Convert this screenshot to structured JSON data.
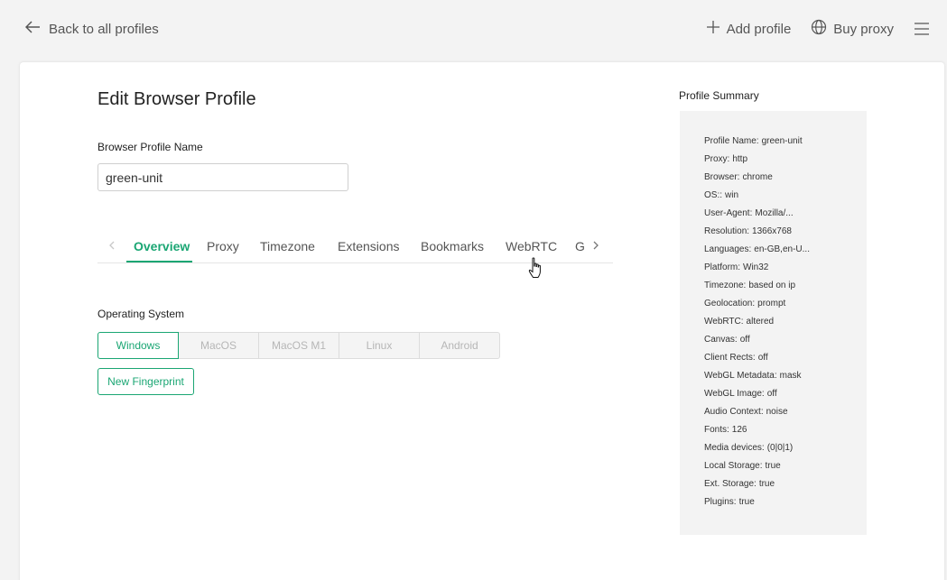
{
  "header": {
    "back_label": "Back to all profiles",
    "add_profile_label": "Add profile",
    "buy_proxy_label": "Buy proxy"
  },
  "form": {
    "title": "Edit Browser Profile",
    "name_label": "Browser Profile Name",
    "name_value": "green-unit"
  },
  "tabs": {
    "items": [
      "Overview",
      "Proxy",
      "Timezone",
      "Extensions",
      "Bookmarks",
      "WebRTC",
      "G"
    ],
    "active": "Overview"
  },
  "os": {
    "label": "Operating System",
    "options": [
      "Windows",
      "MacOS",
      "MacOS M1",
      "Linux",
      "Android"
    ],
    "selected": "Windows",
    "fingerprint_label": "New Fingerprint"
  },
  "summary": {
    "title": "Profile Summary",
    "rows": [
      {
        "key": "Profile Name:",
        "value": "green-unit"
      },
      {
        "key": "Proxy:",
        "value": "http"
      },
      {
        "key": "Browser:",
        "value": "chrome"
      },
      {
        "key": "OS::",
        "value": "win"
      },
      {
        "key": "User-Agent:",
        "value": "Mozilla/..."
      },
      {
        "key": "Resolution:",
        "value": "1366x768"
      },
      {
        "key": "Languages:",
        "value": "en-GB,en-U..."
      },
      {
        "key": "Platform:",
        "value": "Win32"
      },
      {
        "key": "Timezone:",
        "value": "based on ip"
      },
      {
        "key": "Geolocation:",
        "value": "prompt"
      },
      {
        "key": "WebRTC:",
        "value": "altered"
      },
      {
        "key": "Canvas:",
        "value": "off"
      },
      {
        "key": "Client Rects:",
        "value": "off"
      },
      {
        "key": "WebGL Metadata:",
        "value": "mask"
      },
      {
        "key": "WebGL Image:",
        "value": "off"
      },
      {
        "key": "Audio Context:",
        "value": "noise"
      },
      {
        "key": "Fonts:",
        "value": "126"
      },
      {
        "key": "Media devices:",
        "value": "(0|0|1)"
      },
      {
        "key": "Local Storage:",
        "value": "true"
      },
      {
        "key": "Ext. Storage:",
        "value": "true"
      },
      {
        "key": "Plugins:",
        "value": "true"
      }
    ]
  },
  "colors": {
    "accent": "#1aa673",
    "background": "#f3f3f3"
  }
}
